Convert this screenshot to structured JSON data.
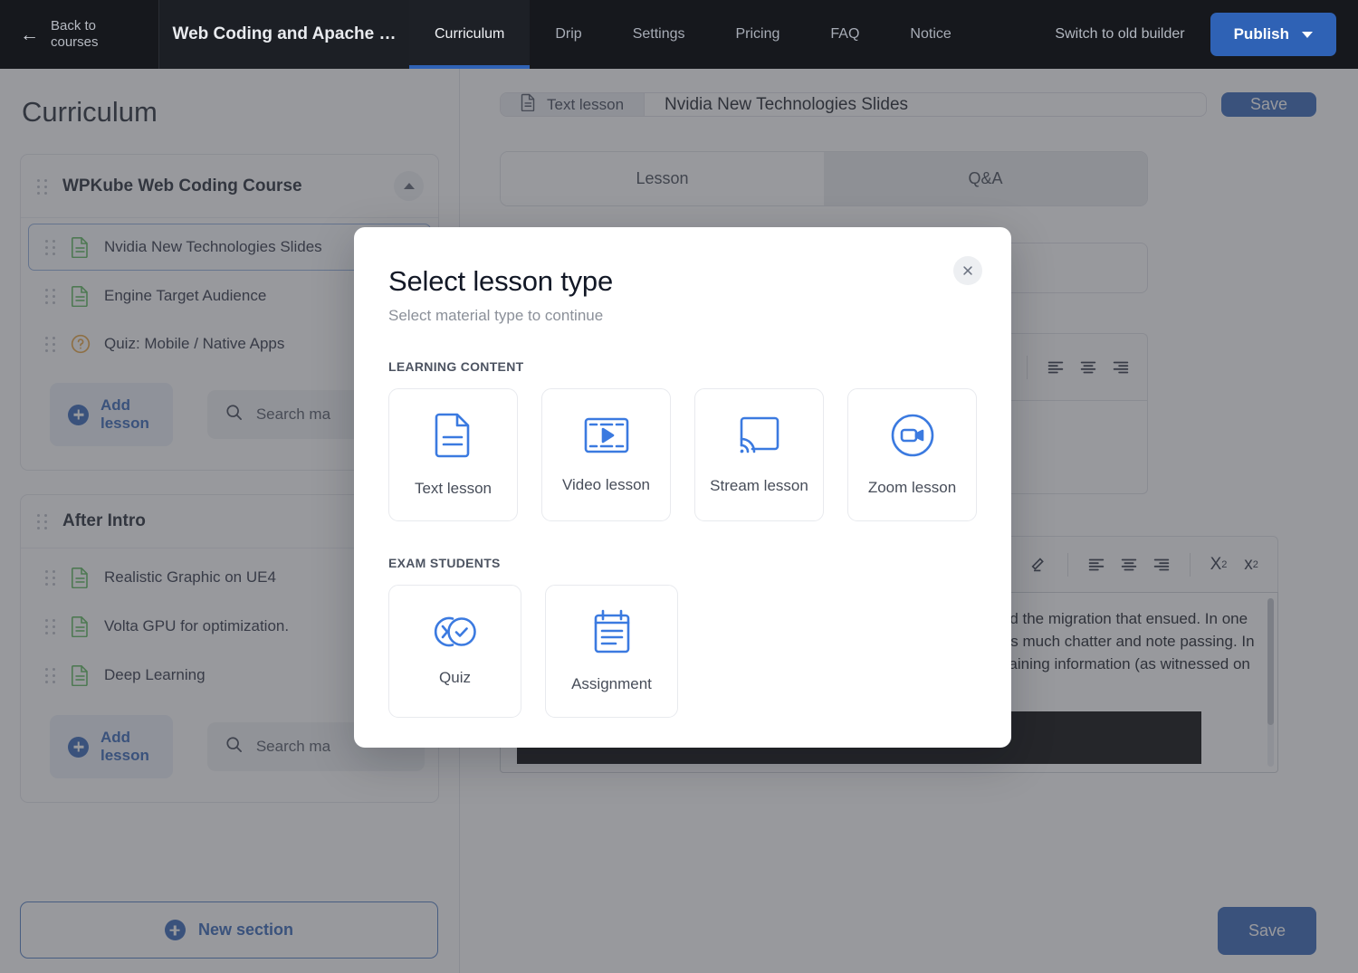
{
  "topbar": {
    "back_label": "Back to courses",
    "back_icon": "arrow-left-icon",
    "course_title": "Web Coding and Apache …",
    "tabs": [
      {
        "label": "Curriculum",
        "active": true
      },
      {
        "label": "Drip",
        "active": false
      },
      {
        "label": "Settings",
        "active": false
      },
      {
        "label": "Pricing",
        "active": false
      },
      {
        "label": "FAQ",
        "active": false
      },
      {
        "label": "Notice",
        "active": false
      }
    ],
    "switch_builder": "Switch to old builder",
    "publish_label": "Publish",
    "publish_caret_icon": "chevron-down-icon",
    "bg_color": "#16181d",
    "accent_color": "#2f62b5"
  },
  "sidebar": {
    "heading": "Curriculum",
    "sections": [
      {
        "title": "WPKube Web Coding Course",
        "collapse_icon": "chevron-up-icon",
        "lessons": [
          {
            "name": "Nvidia New Technologies Slides",
            "icon": "document-icon",
            "selected": true
          },
          {
            "name": "Engine Target Audience",
            "icon": "document-icon",
            "selected": false
          },
          {
            "name": "Quiz: Mobile / Native Apps",
            "icon": "question-circle-icon",
            "selected": false
          }
        ],
        "add_lesson_label": "Add lesson",
        "search_label": "Search ma"
      },
      {
        "title": "After Intro",
        "lessons": [
          {
            "name": "Realistic Graphic on UE4",
            "icon": "document-icon",
            "selected": false
          },
          {
            "name": "Volta GPU for optimization.",
            "icon": "document-icon",
            "selected": false
          },
          {
            "name": "Deep Learning",
            "icon": "document-icon",
            "selected": false
          }
        ],
        "add_lesson_label": "Add lesson",
        "search_label": "Search ma"
      }
    ],
    "new_section_label": "New section",
    "add_icon": "plus-circle-icon",
    "search_icon": "search-icon",
    "drag_icon": "drag-handle-icon"
  },
  "right_panel": {
    "lesson_type_tag": "Text lesson",
    "lesson_type_icon": "document-icon",
    "lesson_title": "Nvidia New Technologies Slides",
    "save_label": "Save",
    "tabs": [
      {
        "label": "Lesson",
        "active": true
      },
      {
        "label": "Q&A",
        "active": false
      }
    ],
    "toolbar_icons_row1": [
      "eraser-icon",
      "align-left-icon",
      "align-center-icon",
      "align-right-icon"
    ],
    "toolbar_icons_row2": [
      "eraser-icon",
      "align-left-icon",
      "align-center-icon",
      "align-right-icon",
      "subscript-icon",
      "superscript-icon"
    ],
    "subscript_label": "X",
    "subscript_sub": "2",
    "superscript_label": "x",
    "superscript_sup": "2",
    "body_text": "Two fourth grade classes are learning about the California Gold Rush and the migration that ensued. In one class, the teacher has difficulty maintaining students’ interest, and there is much chatter and note passing. In the other class, students are out of their seats, actively engaged, and retaining information (as witnessed on test scores)",
    "bottom_save_label": "Save"
  },
  "modal": {
    "title": "Select lesson type",
    "subtitle": "Select material type to continue",
    "close_icon": "close-icon",
    "groups": [
      {
        "label": "LEARNING CONTENT",
        "cards": [
          {
            "label": "Text lesson",
            "icon": "document-icon"
          },
          {
            "label": "Video lesson",
            "icon": "film-play-icon"
          },
          {
            "label": "Stream lesson",
            "icon": "screencast-icon"
          },
          {
            "label": "Zoom lesson",
            "icon": "video-camera-circle-icon"
          }
        ]
      },
      {
        "label": "EXAM STUDENTS",
        "cards": [
          {
            "label": "Quiz",
            "icon": "quiz-check-icon"
          },
          {
            "label": "Assignment",
            "icon": "clipboard-icon"
          }
        ]
      }
    ],
    "icon_color": "#3b7ae0"
  }
}
